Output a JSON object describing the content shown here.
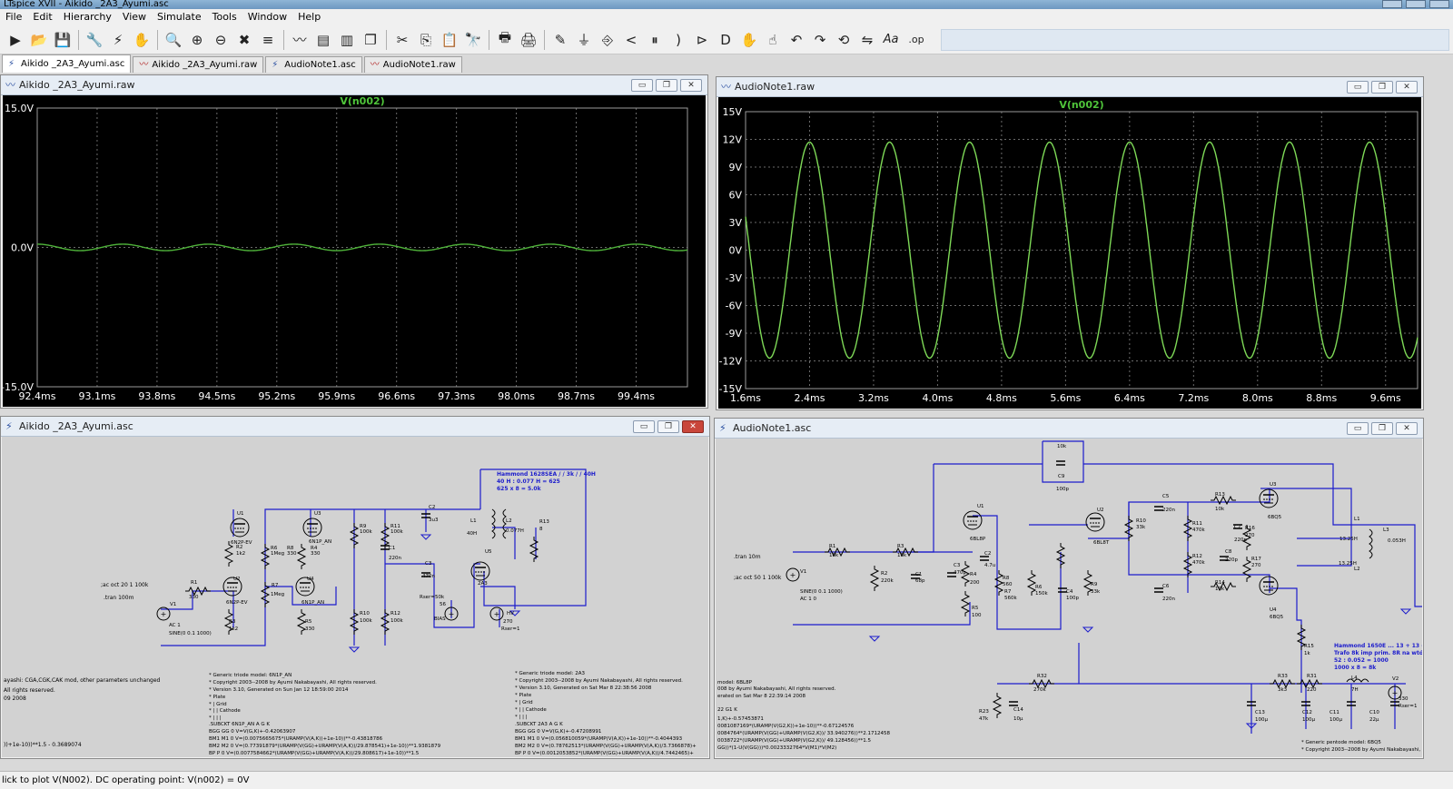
{
  "app": {
    "title": "LTspice XVII - Aikido _2A3_Ayumi.asc"
  },
  "menu": [
    "File",
    "Edit",
    "Hierarchy",
    "View",
    "Simulate",
    "Tools",
    "Window",
    "Help"
  ],
  "toolbar": {
    "icons": [
      "run-icon",
      "open-icon",
      "save-icon",
      "control-panel-icon",
      "probe-icon",
      "pan-icon",
      "zoom-in-icon",
      "zoom-box-icon",
      "zoom-out-icon",
      "zoom-fit-icon",
      "autorange-icon",
      "waveform-icon",
      "tile-horizontal-icon",
      "tile-vertical-icon",
      "cascade-icon",
      "cut-icon",
      "copy-icon",
      "paste-icon",
      "find-icon",
      "print-icon",
      "print-setup-icon",
      "draw-wire-icon",
      "ground-icon",
      "label-net-icon",
      "resistor-icon",
      "capacitor-icon",
      "inductor-icon",
      "diode-icon",
      "component-icon",
      "move-icon",
      "drag-icon",
      "undo-icon",
      "redo-icon",
      "rotate-icon",
      "mirror-icon",
      "text-icon",
      "spice-directive-icon"
    ],
    "glyphs": [
      "▶",
      "📂",
      "💾",
      "🔧",
      "⚡",
      "✋",
      "🔍",
      "⊕",
      "⊖",
      "✖",
      "≡",
      "〰",
      "▤",
      "▥",
      "❐",
      "✂",
      "⎘",
      "📋",
      "🔭",
      "🖶",
      "🖨",
      "✎",
      "⏚",
      "⎆",
      "<",
      "⏸",
      ")",
      "⊳",
      "D",
      "✋",
      "☝",
      "↶",
      "↷",
      "⟲",
      "⇋",
      "Aa",
      ".op"
    ]
  },
  "tabs": [
    {
      "label": "Aikido _2A3_Ayumi.asc",
      "kind": "schematic",
      "active": true
    },
    {
      "label": "Aikido _2A3_Ayumi.raw",
      "kind": "waveform",
      "active": false
    },
    {
      "label": "AudioNote1.asc",
      "kind": "schematic",
      "active": false
    },
    {
      "label": "AudioNote1.raw",
      "kind": "waveform",
      "active": false
    }
  ],
  "windows": {
    "wave1": {
      "title": "Aikido _2A3_Ayumi.raw",
      "trace": "V(n002)"
    },
    "wave2": {
      "title": "AudioNote1.raw",
      "trace": "V(n002)"
    },
    "schem1": {
      "title": "Aikido _2A3_Ayumi.asc"
    },
    "schem2": {
      "title": "AudioNote1.asc"
    }
  },
  "chart_data": [
    {
      "type": "line",
      "title": "V(n002)",
      "x_ticks": [
        "92.4ms",
        "93.1ms",
        "93.8ms",
        "94.5ms",
        "95.2ms",
        "95.9ms",
        "96.6ms",
        "97.3ms",
        "98.0ms",
        "98.7ms",
        "99.4ms"
      ],
      "y_ticks": [
        "15.0V",
        "0.0V",
        "-15.0V"
      ],
      "xlim": [
        92.4,
        100.0
      ],
      "ylim": [
        -15,
        15
      ],
      "series": [
        {
          "color": "#4fb33a",
          "amplitude": 0.35,
          "frequency_khz": 1.0
        }
      ]
    },
    {
      "type": "line",
      "title": "V(n002)",
      "x_ticks": [
        "1.6ms",
        "2.4ms",
        "3.2ms",
        "4.0ms",
        "4.8ms",
        "5.6ms",
        "6.4ms",
        "7.2ms",
        "8.0ms",
        "8.8ms",
        "9.6ms"
      ],
      "y_ticks": [
        "15V",
        "12V",
        "9V",
        "6V",
        "3V",
        "0V",
        "-3V",
        "-6V",
        "-9V",
        "-12V",
        "-15V"
      ],
      "xlim": [
        1.6,
        10.0
      ],
      "ylim": [
        -15,
        15
      ],
      "series": [
        {
          "color": "#7ed957",
          "amplitude": 11.7,
          "frequency_khz": 1.0
        }
      ]
    }
  ],
  "schem1": {
    "labels": [
      {
        "t": "Hammond 1628SEA / / 3k / / 40H",
        "c": "blue"
      },
      {
        "t": "40 H : 0.077 H = 625",
        "c": "blue"
      },
      {
        "t": "625 x 8 = 5.0k",
        "c": "blue"
      },
      {
        "t": "U1",
        "c": "k"
      },
      {
        "t": "6N2P-EV",
        "c": "k"
      },
      {
        "t": "R2",
        "c": "k"
      },
      {
        "t": "1k2",
        "c": "k"
      },
      {
        "t": "U3",
        "c": "k"
      },
      {
        "t": "6N1P_AN",
        "c": "k"
      },
      {
        "t": "R6",
        "c": "k"
      },
      {
        "t": "1Meg",
        "c": "k"
      },
      {
        "t": "R8",
        "c": "k"
      },
      {
        "t": "330",
        "c": "k"
      },
      {
        "t": "R4",
        "c": "k"
      },
      {
        "t": "330",
        "c": "k"
      },
      {
        "t": "R9",
        "c": "k"
      },
      {
        "t": "100k",
        "c": "k"
      },
      {
        "t": "R11",
        "c": "k"
      },
      {
        "t": "100k",
        "c": "k"
      },
      {
        "t": "C2",
        "c": "k"
      },
      {
        "t": "3u3",
        "c": "k"
      },
      {
        "t": "L1",
        "c": "k"
      },
      {
        "t": "40H",
        "c": "k"
      },
      {
        "t": "L2",
        "c": "k"
      },
      {
        "t": "0.077H",
        "c": "k"
      },
      {
        "t": "R13",
        "c": "k"
      },
      {
        "t": "8",
        "c": "k"
      },
      {
        "t": "C1",
        "c": "k"
      },
      {
        "t": "220n",
        "c": "k"
      },
      {
        "t": "C3",
        "c": "k"
      },
      {
        "t": "470n",
        "c": "k"
      },
      {
        "t": "U5",
        "c": "k"
      },
      {
        "t": "2A3",
        "c": "k"
      },
      {
        "t": ";ac oct 20 1 100k",
        "c": "k"
      },
      {
        "t": ".tran 100m",
        "c": "k"
      },
      {
        "t": "R1",
        "c": "k"
      },
      {
        "t": "330",
        "c": "k"
      },
      {
        "t": "U2",
        "c": "k"
      },
      {
        "t": "6N2P-EV",
        "c": "k"
      },
      {
        "t": "R7",
        "c": "k"
      },
      {
        "t": "1Meg",
        "c": "k"
      },
      {
        "t": "U4",
        "c": "k"
      },
      {
        "t": "6N1P_AN",
        "c": "k"
      },
      {
        "t": "V1",
        "c": "k"
      },
      {
        "t": "R3",
        "c": "k"
      },
      {
        "t": "1k2",
        "c": "k"
      },
      {
        "t": "R5",
        "c": "k"
      },
      {
        "t": "330",
        "c": "k"
      },
      {
        "t": "R10",
        "c": "k"
      },
      {
        "t": "100k",
        "c": "k"
      },
      {
        "t": "R12",
        "c": "k"
      },
      {
        "t": "100k",
        "c": "k"
      },
      {
        "t": "Rser=50k",
        "c": "k"
      },
      {
        "t": "56",
        "c": "k"
      },
      {
        "t": "BIAS",
        "c": "k"
      },
      {
        "t": "HV",
        "c": "k"
      },
      {
        "t": "270",
        "c": "k"
      },
      {
        "t": "Rser=1",
        "c": "k"
      },
      {
        "t": "AC 1",
        "c": "k"
      },
      {
        "t": "SINE(0 0.1 1000)",
        "c": "k"
      },
      {
        "t": "ayashi: CGA,CGK,CAK mod, other parameters unchanged",
        "c": "k"
      },
      {
        "t": "All rights reserved.",
        "c": "k"
      },
      {
        "t": "09 2008",
        "c": "k"
      },
      {
        "t": "))+1e-10))**1.5 - 0.3689074",
        "c": "k"
      },
      {
        "t": "* Generic triode model: 6N1P_AN",
        "c": "k"
      },
      {
        "t": "* Copyright 2003--2008 by Ayumi Nakabayashi, All rights reserved.",
        "c": "k"
      },
      {
        "t": "* Version 3.10, Generated on Sun Jan 12 18:59:00 2014",
        "c": "k"
      },
      {
        "t": "*               Plate",
        "c": "k"
      },
      {
        "t": "*               | Grid",
        "c": "k"
      },
      {
        "t": "*               | | Cathode",
        "c": "k"
      },
      {
        "t": "*               | | |",
        "c": "k"
      },
      {
        "t": ".SUBCKT 6N1P_AN A G K",
        "c": "k"
      },
      {
        "t": "BGG   GG   0 V=V(G,K)+-0.42063907",
        "c": "k"
      },
      {
        "t": "BM1   M1   0 V=(0.0075665675*(URAMP(V(A,K))+1e-10))**-0.43818786",
        "c": "k"
      },
      {
        "t": "BM2   M2   0 V=(0.77391879*(URAMP(V(GG)+URAMP(V(A,K))/29.878541)+1e-10))**1.9381879",
        "c": "k"
      },
      {
        "t": "BP    P    0 V=(0.0077584662*(URAMP(V(GG)+URAMP(V(A,K))/29.808617)+1e-10))**1.5",
        "c": "k"
      },
      {
        "t": "* Generic triode model: 2A3",
        "c": "k"
      },
      {
        "t": "* Copyright 2003--2008 by Ayumi Nakabayashi, All rights reserved.",
        "c": "k"
      },
      {
        "t": "* Version 3.10, Generated on Sat Mar  8 22:38:56 2008",
        "c": "k"
      },
      {
        "t": "*               Plate",
        "c": "k"
      },
      {
        "t": "*               | Grid",
        "c": "k"
      },
      {
        "t": "*               | | Cathode",
        "c": "k"
      },
      {
        "t": "*               | | |",
        "c": "k"
      },
      {
        "t": ".SUBCKT 2A3 A G K",
        "c": "k"
      },
      {
        "t": "BGG   GG   0 V=V(G,K)+-0.47208991",
        "c": "k"
      },
      {
        "t": "BM1   M1   0 V=(0.056810059*(URAMP(V(A,K))+1e-10))**-0.4044393",
        "c": "k"
      },
      {
        "t": "BM2   M2   0 V=(0.78762513*(URAMP(V(GG)+URAMP(V(A,K))/3.7366878)+",
        "c": "k"
      },
      {
        "t": "BP    P    0 V=(0.0012053852*(URAMP(V(GG)+URAMP(V(A,K))/4.7442465)+",
        "c": "k"
      }
    ]
  },
  "schem2": {
    "labels": [
      {
        "t": "10k",
        "c": "k"
      },
      {
        "t": "C9",
        "c": "k"
      },
      {
        "t": "100p",
        "c": "k"
      },
      {
        "t": "U1",
        "c": "k"
      },
      {
        "t": "6BL8P",
        "c": "k"
      },
      {
        "t": "U2",
        "c": "k"
      },
      {
        "t": "6BL8T",
        "c": "k"
      },
      {
        "t": "C5",
        "c": "k"
      },
      {
        "t": "220n",
        "c": "k"
      },
      {
        "t": "R13",
        "c": "k"
      },
      {
        "t": "10k",
        "c": "k"
      },
      {
        "t": "U3",
        "c": "k"
      },
      {
        "t": "6BQ5",
        "c": "k"
      },
      {
        "t": "L1",
        "c": "k"
      },
      {
        "t": "L3",
        "c": "k"
      },
      {
        "t": "R16",
        "c": "k"
      },
      {
        "t": "270",
        "c": "k"
      },
      {
        "t": "C7",
        "c": "k"
      },
      {
        "t": "220p",
        "c": "k"
      },
      {
        "t": "R11",
        "c": "k"
      },
      {
        "t": "470k",
        "c": "k"
      },
      {
        "t": "R10",
        "c": "k"
      },
      {
        "t": "33k",
        "c": "k"
      },
      {
        "t": "13.25H",
        "c": "k"
      },
      {
        "t": "0.053H",
        "c": "k"
      },
      {
        "t": ".tran 10m",
        "c": "k"
      },
      {
        "t": "R1",
        "c": "k"
      },
      {
        "t": "10k",
        "c": "k"
      },
      {
        "t": "R3",
        "c": "k"
      },
      {
        "t": "10k",
        "c": "k"
      },
      {
        "t": "R8",
        "c": "k"
      },
      {
        "t": "560",
        "c": "k"
      },
      {
        "t": "C2",
        "c": "k"
      },
      {
        "t": "4.7u",
        "c": "k"
      },
      {
        "t": "R12",
        "c": "k"
      },
      {
        "t": "470k",
        "c": "k"
      },
      {
        "t": "C8",
        "c": "k"
      },
      {
        "t": "220p",
        "c": "k"
      },
      {
        "t": "R17",
        "c": "k"
      },
      {
        "t": "270",
        "c": "k"
      },
      {
        "t": "13.25H",
        "c": "k"
      },
      {
        "t": "L2",
        "c": "k"
      },
      {
        "t": ";ac oct 50 1 100k",
        "c": "k"
      },
      {
        "t": "V1",
        "c": "k"
      },
      {
        "t": "R2",
        "c": "k"
      },
      {
        "t": "220k",
        "c": "k"
      },
      {
        "t": "C1",
        "c": "k"
      },
      {
        "t": "68p",
        "c": "k"
      },
      {
        "t": "C3",
        "c": "k"
      },
      {
        "t": "470p",
        "c": "k"
      },
      {
        "t": "R4",
        "c": "k"
      },
      {
        "t": "200",
        "c": "k"
      },
      {
        "t": "R7",
        "c": "k"
      },
      {
        "t": "560k",
        "c": "k"
      },
      {
        "t": "R6",
        "c": "k"
      },
      {
        "t": "150k",
        "c": "k"
      },
      {
        "t": "C4",
        "c": "k"
      },
      {
        "t": "100p",
        "c": "k"
      },
      {
        "t": "R9",
        "c": "k"
      },
      {
        "t": "33k",
        "c": "k"
      },
      {
        "t": "C6",
        "c": "k"
      },
      {
        "t": "220n",
        "c": "k"
      },
      {
        "t": "R14",
        "c": "k"
      },
      {
        "t": "10k",
        "c": "k"
      },
      {
        "t": "U4",
        "c": "k"
      },
      {
        "t": "6BQ5",
        "c": "k"
      },
      {
        "t": "SINE(0 0.1 1000)",
        "c": "k"
      },
      {
        "t": "AC 1 0",
        "c": "k"
      },
      {
        "t": "R5",
        "c": "k"
      },
      {
        "t": "100",
        "c": "k"
      },
      {
        "t": "R15",
        "c": "k"
      },
      {
        "t": "1k",
        "c": "k"
      },
      {
        "t": "Hammond 1650E ... 13 + 13 = 26",
        "c": "blue"
      },
      {
        "t": "Trafo 8k imp prim. 8R na wtórym",
        "c": "blue"
      },
      {
        "t": "52 : 0.052 = 1000",
        "c": "blue"
      },
      {
        "t": "1000 x 8 = 8k",
        "c": "blue"
      },
      {
        "t": "model: 6BL8P",
        "c": "k"
      },
      {
        "t": "008 by Ayumi Nakabayashi, All rights reserved.",
        "c": "k"
      },
      {
        "t": "erated on Sat Mar  8 22:39:14 2008",
        "c": "k"
      },
      {
        "t": "R32",
        "c": "k"
      },
      {
        "t": "270k",
        "c": "k"
      },
      {
        "t": "R33",
        "c": "k"
      },
      {
        "t": "3k3",
        "c": "k"
      },
      {
        "t": "R31",
        "c": "k"
      },
      {
        "t": "220",
        "c": "k"
      },
      {
        "t": "L4",
        "c": "k"
      },
      {
        "t": "7H",
        "c": "k"
      },
      {
        "t": "V2",
        "c": "k"
      },
      {
        "t": "R23",
        "c": "k"
      },
      {
        "t": "47k",
        "c": "k"
      },
      {
        "t": "C14",
        "c": "k"
      },
      {
        "t": "10µ",
        "c": "k"
      },
      {
        "t": "C13",
        "c": "k"
      },
      {
        "t": "100µ",
        "c": "k"
      },
      {
        "t": "C12",
        "c": "k"
      },
      {
        "t": "100µ",
        "c": "k"
      },
      {
        "t": "C11",
        "c": "k"
      },
      {
        "t": "100µ",
        "c": "k"
      },
      {
        "t": "C10",
        "c": "k"
      },
      {
        "t": "22µ",
        "c": "k"
      },
      {
        "t": "330",
        "c": "k"
      },
      {
        "t": "Rser=1",
        "c": "k"
      },
      {
        "t": "22 G1 K",
        "c": "k"
      },
      {
        "t": "1,K)+-0.57453871",
        "c": "k"
      },
      {
        "t": "0081087169*(URAMP(V(G2,K))+1e-10))**-0.67124576",
        "c": "k"
      },
      {
        "t": "0084764*(URAMP(V(GG)+URAMP(V(G2,K))/ 33.940276))**2.1712458",
        "c": "k"
      },
      {
        "t": "0038722*(URAMP(V(GG)+URAMP(V(G2,K))/ 49.128456))**1.5",
        "c": "k"
      },
      {
        "t": "GG))*(1-U(V(GG)))*0.0023332764*V(M1)*V(M2)",
        "c": "k"
      },
      {
        "t": "* Generic pentode model: 6BQ5",
        "c": "k"
      },
      {
        "t": "* Copyright 2003--2008 by Ayumi Nakabayashi,",
        "c": "k"
      }
    ]
  },
  "statusbar": {
    "text": "lick to plot V(N002).  DC operating point: V(n002) = 0V"
  }
}
